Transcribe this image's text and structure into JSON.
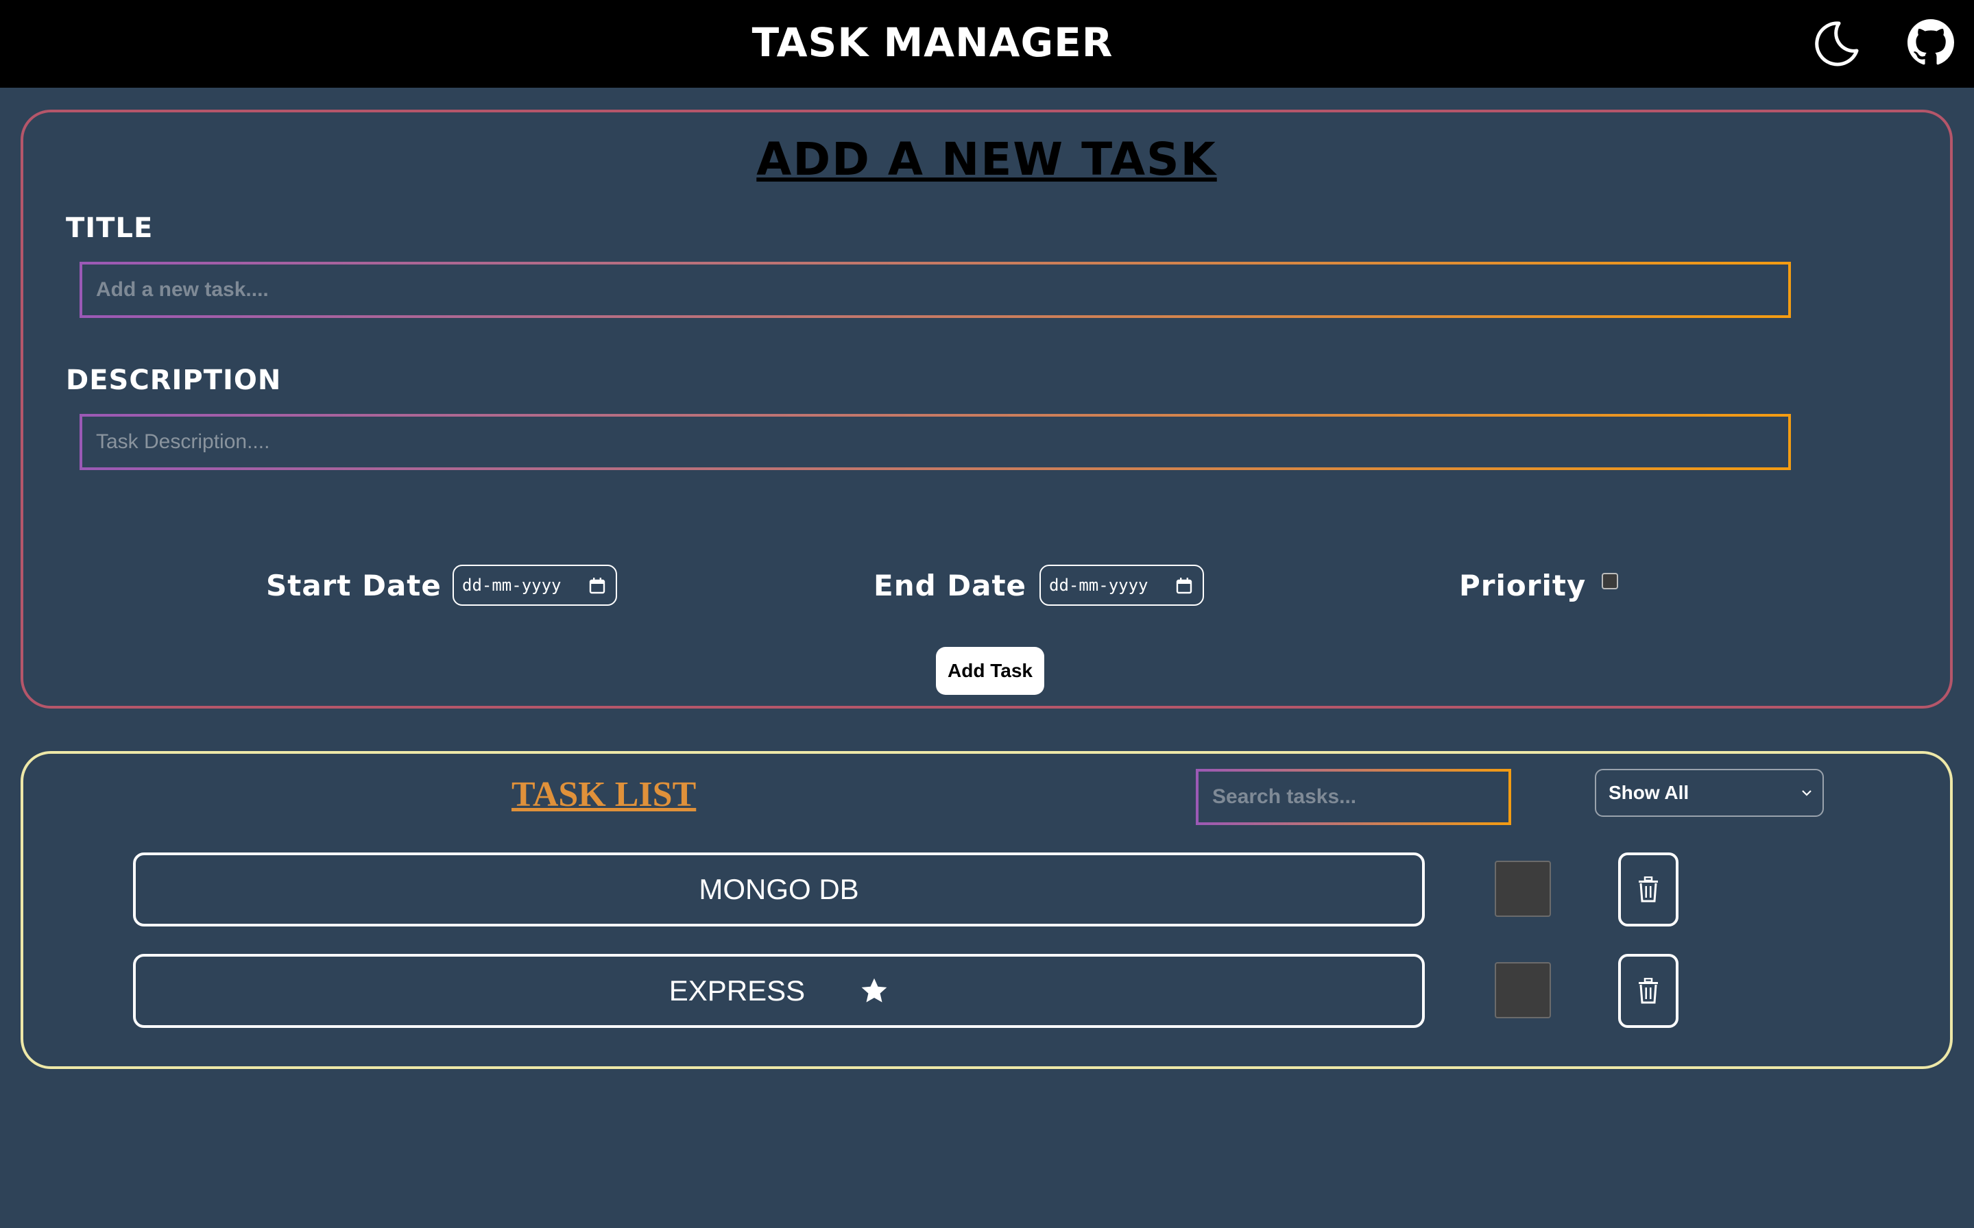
{
  "header": {
    "title": "TASK MANAGER",
    "icons": [
      "moon-icon",
      "github-icon"
    ]
  },
  "add_form": {
    "heading": "ADD A NEW TASK",
    "title_label": "TITLE",
    "title_placeholder": "Add a new task....",
    "title_value": "",
    "description_label": "DESCRIPTION",
    "description_placeholder": "Task Description....",
    "description_value": "",
    "start_date_label": "Start Date",
    "start_date_value": "dd-mm-yyyy",
    "end_date_label": "End Date",
    "end_date_value": "dd-mm-yyyy",
    "priority_label": "Priority",
    "priority_checked": false,
    "add_button_label": "Add Task"
  },
  "task_list": {
    "heading": "TASK LIST",
    "search_placeholder": "Search tasks...",
    "filter_selected": "Show All",
    "tasks": [
      {
        "title": "MONGO DB",
        "priority": false,
        "completed": false
      },
      {
        "title": "EXPRESS",
        "priority": true,
        "completed": false
      }
    ]
  },
  "colors": {
    "background": "#2f4358",
    "header_bg": "#000000",
    "add_panel_border": "#b5566a",
    "list_panel_border": "#eee8a8",
    "list_heading": "#e0913a",
    "input_gradient_start": "#9b59b6",
    "input_gradient_end": "#f39c12"
  }
}
